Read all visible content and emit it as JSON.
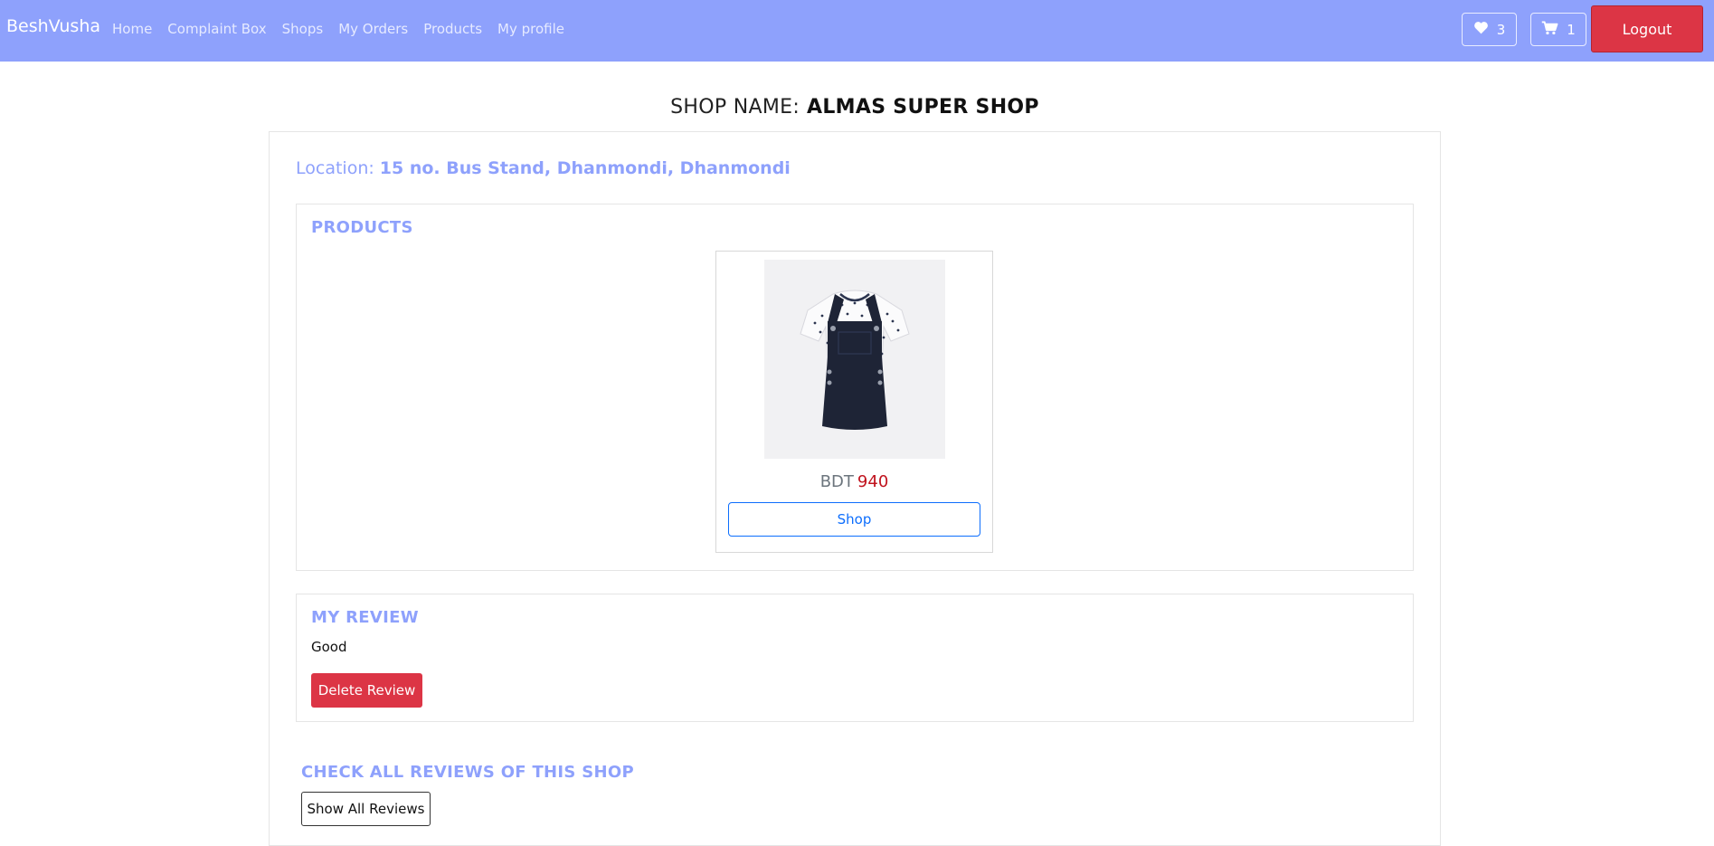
{
  "navbar": {
    "brand": "BeshVusha",
    "links": [
      "Home",
      "Complaint Box",
      "Shops",
      "My Orders",
      "Products",
      "My profile"
    ],
    "wishlist_count": "3",
    "cart_count": "1",
    "logout_label": "Logout"
  },
  "shop": {
    "title_label": "SHOP NAME:",
    "name": "ALMAS SUPER SHOP",
    "location_label": "Location:",
    "location_value": "15 no. Bus Stand, Dhanmondi,  Dhanmondi"
  },
  "products": {
    "title": "PRODUCTS",
    "items": [
      {
        "currency": "BDT",
        "price": "940",
        "button_label": "Shop",
        "image": "dungaree-dress-with-polka-dot-tee"
      }
    ]
  },
  "my_review": {
    "title": "MY REVIEW",
    "text": "Good",
    "delete_label": "Delete Review"
  },
  "all_reviews": {
    "title": "CHECK ALL REVIEWS OF THIS SHOP",
    "button_label": "Show All Reviews"
  },
  "colors": {
    "navbar_bg": "#8ea1fc",
    "accent": "#8ea1fc",
    "danger": "#dc3545",
    "primary": "#0d6efd",
    "price": "#c0121d"
  },
  "icons": {
    "wishlist": "heart-icon",
    "cart": "cart-icon"
  }
}
